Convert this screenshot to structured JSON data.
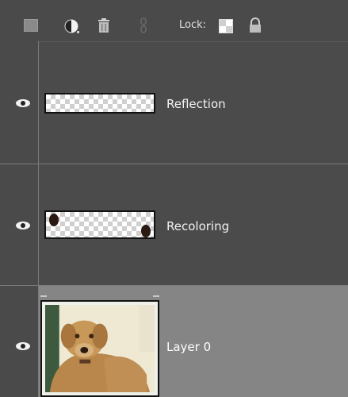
{
  "toolbar": {
    "lock_label": "Lock:",
    "icons": [
      "new-layer-icon",
      "adjustment-layer-icon",
      "trash-icon",
      "link-icon",
      "lock-transparent-icon",
      "lock-all-icon"
    ]
  },
  "layers": [
    {
      "name": "Reflection",
      "visible": true,
      "thumbnail": "transparent"
    },
    {
      "name": "Recoloring",
      "visible": true,
      "thumbnail": "transparent-with-dark-spots"
    },
    {
      "name": "Layer 0",
      "visible": true,
      "selected": true,
      "thumbnail": "dog-photo"
    }
  ],
  "colors": {
    "panel_bg": "#4b4b4b",
    "selected_row_bg": "#858585",
    "text": "#f2f2f2",
    "divider": "#7b7b7b"
  }
}
